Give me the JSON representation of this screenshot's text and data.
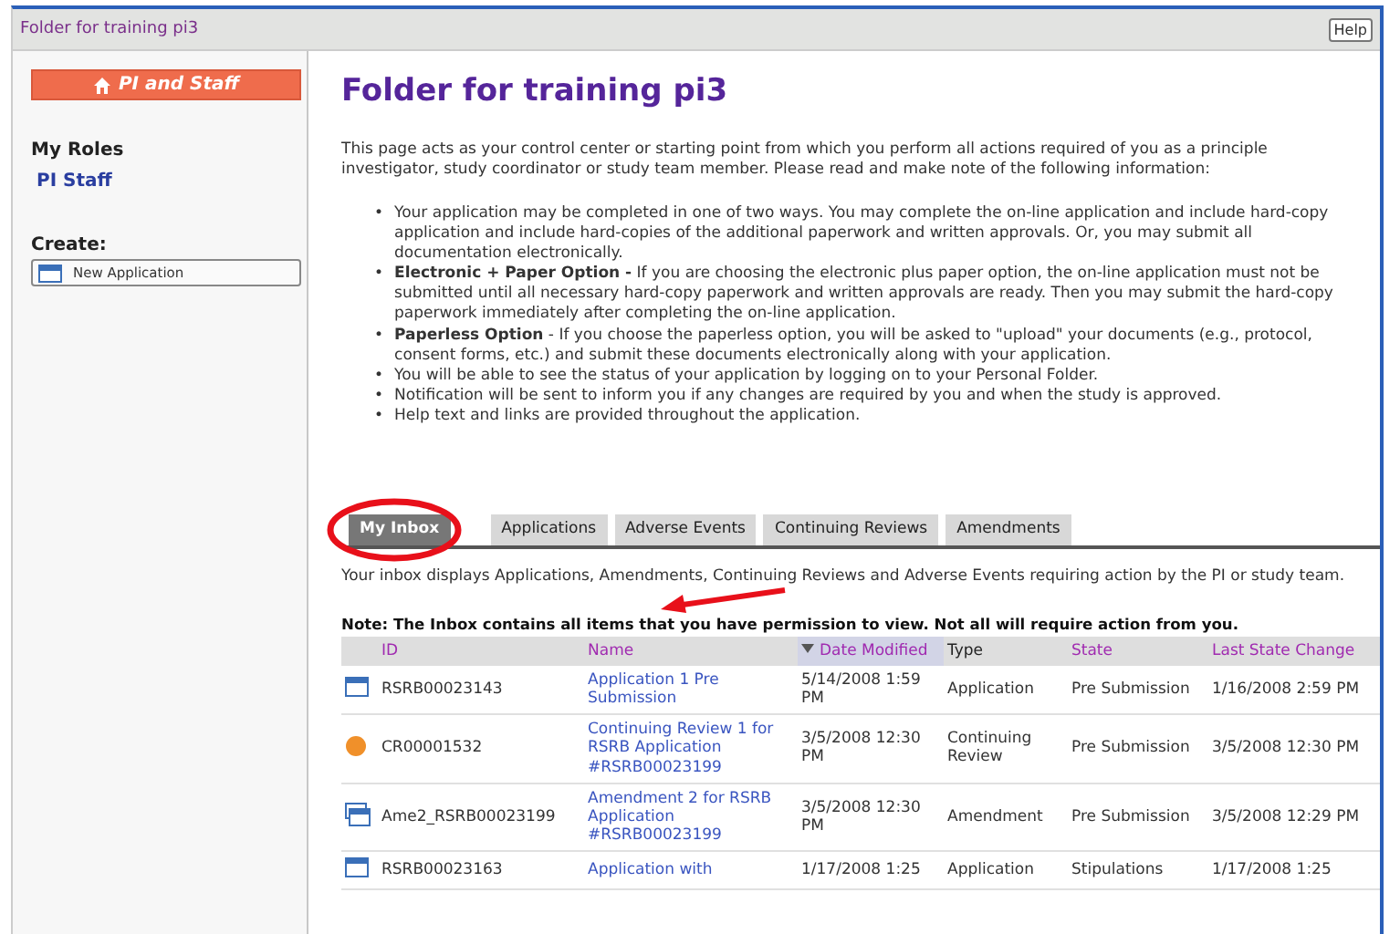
{
  "window": {
    "title": "Folder for training pi3",
    "help_button": "Help"
  },
  "sidebar": {
    "home_button": "PI and Staff",
    "roles_heading": "My Roles",
    "roles": [
      "PI Staff"
    ],
    "create_heading": "Create:",
    "create_items": [
      "New Application"
    ]
  },
  "main": {
    "heading": "Folder for training pi3",
    "intro": "This page acts as your control center or starting point from which you perform all actions required of you as a principle investigator, study coordinator or study team member.  Please read and make note of the following information:",
    "bullet_marker": "•",
    "bullets": [
      "Your application may be completed in one of two ways. You may complete the on-line application and include hard-copy application and include hard-copies of the additional paperwork and written approvals. Or, you may submit all documentation electronically.",
      "**Electronic + Paper Option -** If you are choosing the electronic plus paper option, the on-line application must not be submitted until all necessary hard-copy paperwork and written approvals are ready. Then you may submit the hard-copy paperwork immediately after completing the on-line application.",
      "**Paperless Option** - If you choose the paperless option, you will be asked to \"upload\" your documents (e.g., protocol, consent forms, etc.) and submit these documents electronically along with your application.",
      "You will be able to see the status of your application by logging on to your Personal Folder.",
      "Notification will be sent to inform you if any changes are required by you and when the study is approved.",
      "Help text and links are provided throughout the application."
    ],
    "tabs": [
      {
        "label": "My Inbox",
        "selected": true
      },
      {
        "label": "Applications",
        "selected": false
      },
      {
        "label": "Adverse Events",
        "selected": false
      },
      {
        "label": "Continuing Reviews",
        "selected": false
      },
      {
        "label": "Amendments",
        "selected": false
      }
    ],
    "inbox_description": "Your inbox displays Applications, Amendments, Continuing Reviews and Adverse Events requiring action by the PI or study team.",
    "note": "Note: The Inbox contains all items that you have permission to view. Not all will require action from you.",
    "table": {
      "columns": [
        {
          "label": "ID",
          "sortable": true,
          "sorted": false
        },
        {
          "label": "Name",
          "sortable": true,
          "sorted": false
        },
        {
          "label": "Date Modified",
          "sortable": true,
          "sorted": true
        },
        {
          "label": "Type",
          "sortable": false,
          "sorted": false
        },
        {
          "label": "State",
          "sortable": true,
          "sorted": false
        },
        {
          "label": "Last State Change",
          "sortable": true,
          "sorted": false
        }
      ],
      "rows": [
        {
          "kind": "application",
          "id": "RSRB00023143",
          "name": "Application 1 Pre Submission",
          "date_modified": "5/14/2008 1:59 PM",
          "type": "Application",
          "state": "Pre Submission",
          "last_state_change": "1/16/2008 2:59 PM"
        },
        {
          "kind": "review",
          "id": "CR00001532",
          "name": "Continuing Review 1 for RSRB Application #RSRB00023199",
          "date_modified": "3/5/2008 12:30 PM",
          "type": "Continuing Review",
          "state": "Pre Submission",
          "last_state_change": "3/5/2008 12:30 PM"
        },
        {
          "kind": "amendment",
          "id": "Ame2_RSRB00023199",
          "name": "Amendment 2 for RSRB Application #RSRB00023199",
          "date_modified": "3/5/2008 12:30 PM",
          "type": "Amendment",
          "state": "Pre Submission",
          "last_state_change": "3/5/2008 12:29 PM"
        },
        {
          "kind": "application",
          "id": "RSRB00023163",
          "name": "Application with",
          "date_modified": "1/17/2008 1:25",
          "type": "Application",
          "state": "Stipulations",
          "last_state_change": "1/17/2008 1:25"
        }
      ]
    }
  },
  "annotations": {
    "highlight_ellipse": true,
    "arrow": true
  }
}
